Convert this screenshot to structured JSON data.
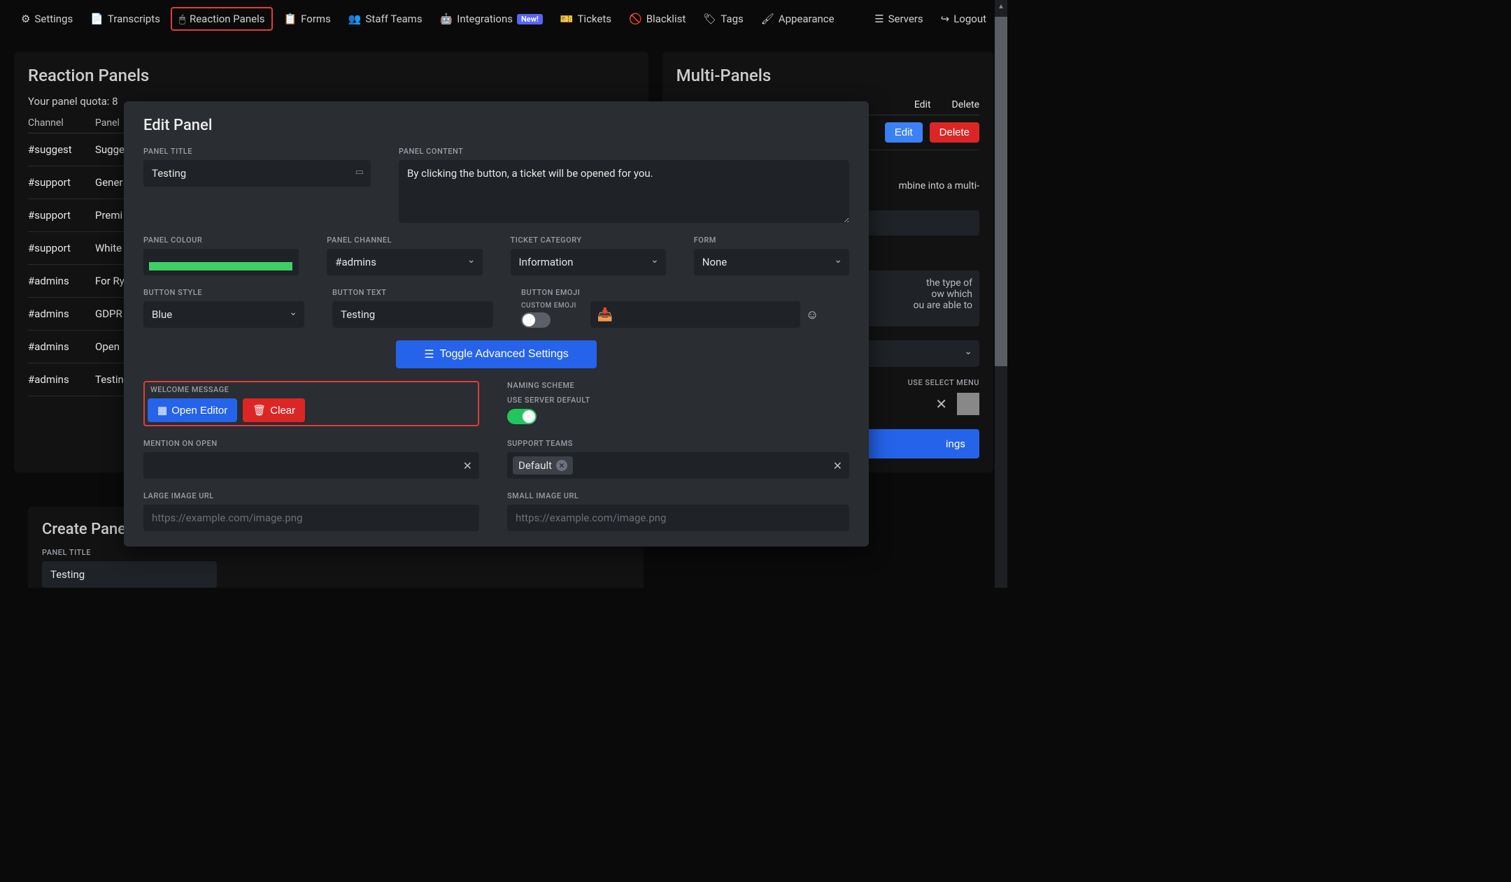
{
  "nav": {
    "left": [
      {
        "icon": "⚙",
        "label": "Settings"
      },
      {
        "icon": "📄",
        "label": "Transcripts"
      },
      {
        "icon": "🖱",
        "label": "Reaction Panels",
        "highlighted": true
      },
      {
        "icon": "📋",
        "label": "Forms"
      },
      {
        "icon": "👥",
        "label": "Staff Teams"
      },
      {
        "icon": "🤖",
        "label": "Integrations",
        "badge": "New!"
      },
      {
        "icon": "🎫",
        "label": "Tickets"
      },
      {
        "icon": "🚫",
        "label": "Blacklist"
      },
      {
        "icon": "🏷",
        "label": "Tags"
      },
      {
        "icon": "🖌",
        "label": "Appearance"
      }
    ],
    "right": [
      {
        "icon": "☰",
        "label": "Servers"
      },
      {
        "icon": "↪",
        "label": "Logout"
      }
    ]
  },
  "left_panel": {
    "title": "Reaction Panels",
    "quota": "Your panel quota: 8",
    "cols": [
      "Channel",
      "Panel"
    ],
    "rows": [
      {
        "channel": "#suggest",
        "panel": "Sugge"
      },
      {
        "channel": "#support",
        "panel": "Gener"
      },
      {
        "channel": "#support",
        "panel": "Premi"
      },
      {
        "channel": "#support",
        "panel": "White"
      },
      {
        "channel": "#admins",
        "panel": "For Ry"
      },
      {
        "channel": "#admins",
        "panel": "GDPR"
      },
      {
        "channel": "#admins",
        "panel": "Open"
      },
      {
        "channel": "#admins",
        "panel": "Testin"
      }
    ]
  },
  "right_panel": {
    "title": "Multi-Panels",
    "head_edit": "Edit",
    "head_delete": "Delete",
    "edit_btn": "Edit",
    "delete_btn": "Delete",
    "combine_text": "mbine into a multi-",
    "scroll_text": "the type of\now which\nou are able to",
    "use_select": "USE SELECT MENU",
    "settings": "ings"
  },
  "create_panel": {
    "title": "Create Panel",
    "label_title": "PANEL TITLE",
    "value": "Testing"
  },
  "modal": {
    "title": "Edit Panel",
    "labels": {
      "panel_title": "PANEL TITLE",
      "panel_content": "PANEL CONTENT",
      "panel_colour": "PANEL COLOUR",
      "panel_channel": "PANEL CHANNEL",
      "ticket_category": "TICKET CATEGORY",
      "form": "FORM",
      "button_style": "BUTTON STYLE",
      "button_text": "BUTTON TEXT",
      "button_emoji": "BUTTON EMOJI",
      "custom_emoji": "CUSTOM EMOJI",
      "toggle_advanced": "Toggle Advanced Settings",
      "welcome_message": "WELCOME MESSAGE",
      "open_editor": "Open Editor",
      "clear": "Clear",
      "naming_scheme": "NAMING SCHEME",
      "use_server_default": "USE SERVER DEFAULT",
      "mention_on_open": "MENTION ON OPEN",
      "support_teams": "SUPPORT TEAMS",
      "large_image": "LARGE IMAGE URL",
      "small_image": "SMALL IMAGE URL"
    },
    "values": {
      "panel_title": "Testing",
      "panel_content": "By clicking the button, a ticket will be opened for you.",
      "panel_channel": "#admins",
      "ticket_category": "Information",
      "form": "None",
      "button_style": "Blue",
      "button_text": "Testing",
      "emoji": "📥",
      "support_tag": "Default",
      "image_placeholder": "https://example.com/image.png"
    }
  }
}
